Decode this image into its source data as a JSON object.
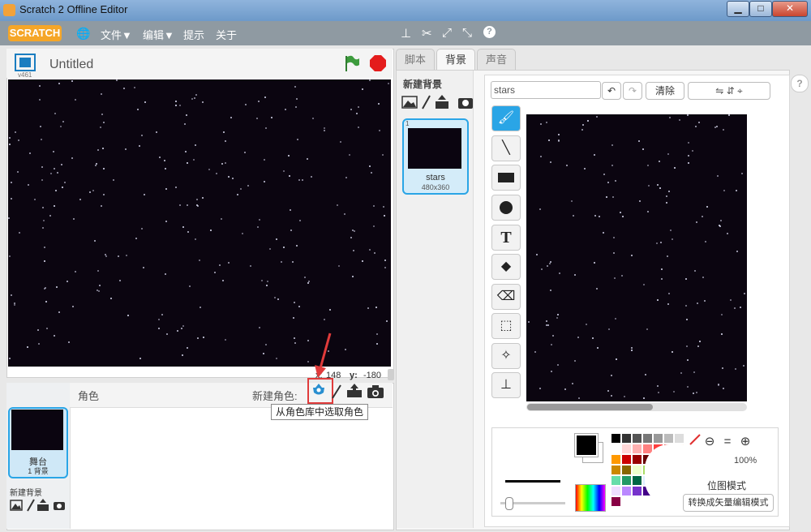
{
  "window": {
    "title": "Scratch 2 Offline Editor",
    "minimize": "▁",
    "maximize": "□",
    "close": "✕"
  },
  "menu": {
    "logo": "SCRATCH",
    "globe": "🌐",
    "file": "文件▼",
    "edit": "编辑▼",
    "tips": "提示",
    "about": "关于"
  },
  "stage": {
    "title": "Untitled",
    "version": "v461",
    "x_label": "x:",
    "x_value": "148",
    "y_label": "y:",
    "y_value": "-180"
  },
  "sprites": {
    "header": "角色",
    "new_sprite_label": "新建角色:",
    "tooltip": "从角色库中选取角色",
    "stage_label": "舞台",
    "stage_count": "1 背景",
    "new_backdrop_label": "新建背景"
  },
  "tabs": {
    "scripts": "脚本",
    "backdrops": "背景",
    "sounds": "声音"
  },
  "backdrops": {
    "new_backdrop": "新建背景",
    "items": [
      {
        "index": "1",
        "name": "stars",
        "size": "480x360"
      }
    ]
  },
  "editor": {
    "name_value": "stars",
    "clear": "清除",
    "zoom_percent": "100%",
    "vector_mode": "转换成矢量编辑模式",
    "bitmap_label": "位图模式",
    "help": "?"
  },
  "colors": {
    "accent": "#2aa5e6",
    "menubar": "#8f9aa2",
    "stage_bg": "#0b0510",
    "logo": "#f5a628"
  },
  "palette": [
    "#000000",
    "#333333",
    "#555555",
    "#777777",
    "#999999",
    "#bbbbbb",
    "#dddddd",
    "#ffffff",
    "#ffd7d7",
    "#ffb0b0",
    "#ff8080",
    "#ff4040",
    "#e00000",
    "#ffe0c0",
    "#ff9900",
    "#cc0000",
    "#990000",
    "#660000"
  ]
}
